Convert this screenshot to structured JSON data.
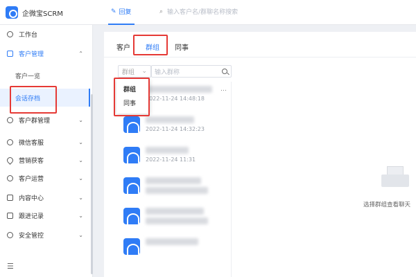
{
  "app": {
    "name": "企微宝SCRM"
  },
  "topbar": {
    "tab_label": "回复",
    "search_placeholder": "输入客户名/群聊名称搜索"
  },
  "sidebar": {
    "items": [
      {
        "label": "工作台",
        "icon": "home-icon"
      },
      {
        "label": "客户管理",
        "icon": "users-icon",
        "expanded": true
      },
      {
        "label": "客户一览"
      },
      {
        "label": "会话存档",
        "active": true
      },
      {
        "label": "客户群管理",
        "icon": "group-icon"
      },
      {
        "label": "微信客服",
        "icon": "service-icon"
      },
      {
        "label": "营销获客",
        "icon": "location-icon"
      },
      {
        "label": "客户运营",
        "icon": "operate-icon"
      },
      {
        "label": "内容中心",
        "icon": "content-icon"
      },
      {
        "label": "跟进记录",
        "icon": "record-icon"
      },
      {
        "label": "安全管控",
        "icon": "shield-icon"
      }
    ]
  },
  "main": {
    "tabs": [
      {
        "label": "客户"
      },
      {
        "label": "群组",
        "active": true
      },
      {
        "label": "同事"
      }
    ],
    "filter_label": "群组",
    "search_placeholder": "输入群称",
    "dropdown": [
      {
        "label": "群组"
      },
      {
        "label": "同事"
      }
    ],
    "rows": [
      {
        "time": "2022-11-24 14:48:18"
      },
      {
        "time": "2022-11-24 14:32:23"
      },
      {
        "time": "2022-11-24 11:31"
      },
      {
        "time": ""
      },
      {
        "time": ""
      },
      {
        "time": ""
      }
    ],
    "empty_text": "选择群组查看聊天"
  },
  "colors": {
    "accent": "#2f7cf6",
    "highlight": "#e53935"
  }
}
